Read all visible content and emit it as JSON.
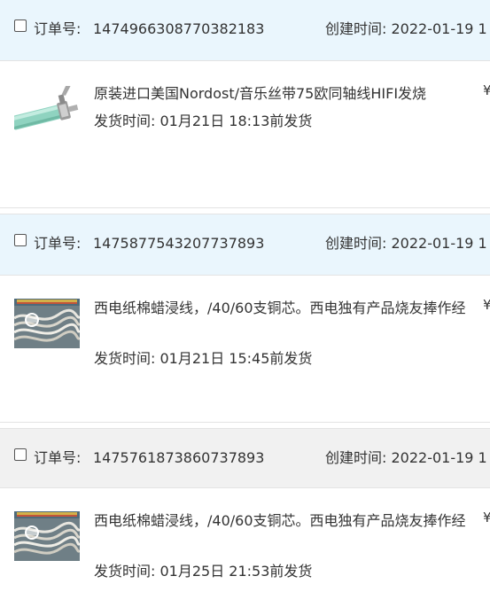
{
  "orders": [
    {
      "checkbox": false,
      "order_no_label": "订单号:",
      "order_no": "1474966308770382183",
      "created": "创建时间: 2022-01-19 1",
      "title": "原装进口美国Nordost/音乐丝带75欧同轴线HIFI发烧",
      "ship_time": "发货时间:  01月21日 18:13前发货",
      "price_symbol": "¥"
    },
    {
      "checkbox": false,
      "order_no_label": "订单号:",
      "order_no": "1475877543207737893",
      "created": "创建时间: 2022-01-19 1",
      "title": "西电纸棉蜡浸线，/40/60支铜芯。西电独有产品烧友捧作经",
      "ship_time": "发货时间:  01月21日 15:45前发货",
      "price_symbol": "¥"
    },
    {
      "checkbox": false,
      "order_no_label": "订单号:",
      "order_no": "1475761873860737893",
      "created": "创建时间: 2022-01-19 1",
      "title": "西电纸棉蜡浸线，/40/60支铜芯。西电独有产品烧友捧作经",
      "ship_time": "发货时间:  01月25日 21:53前发货",
      "price_symbol": "¥"
    }
  ],
  "colors": {
    "header_blue": "#eaf6fd",
    "header_gray": "#f1f1f1",
    "cable_teal": "#8fd3c0",
    "text": "#333333"
  }
}
